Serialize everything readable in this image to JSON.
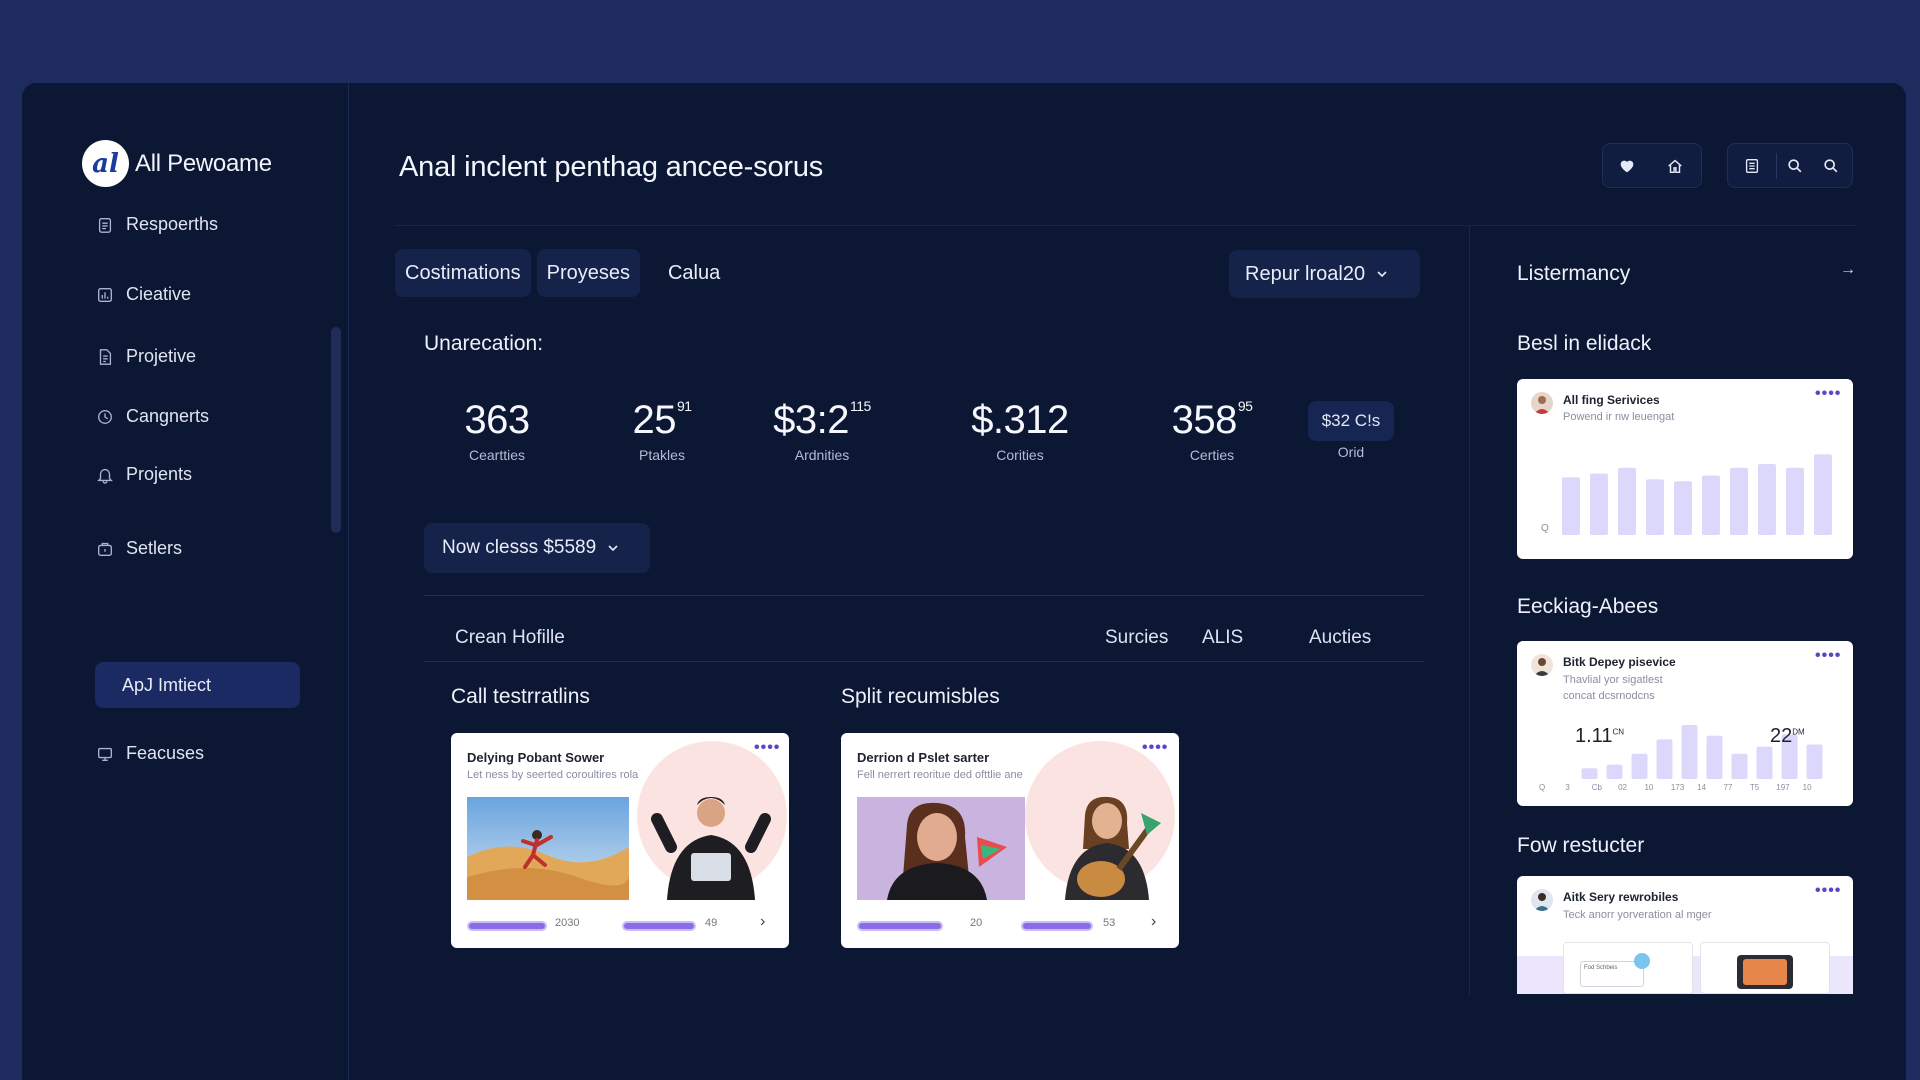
{
  "app": {
    "name": "All Pewoame",
    "logo_glyph": "al"
  },
  "sidebar": {
    "items": [
      {
        "label": "Respoerths",
        "icon": "clipboard-icon"
      },
      {
        "label": "Cieative",
        "icon": "chart-icon"
      },
      {
        "label": "Projetive",
        "icon": "document-icon"
      },
      {
        "label": "Cangnerts",
        "icon": "clock-icon"
      },
      {
        "label": "Projents",
        "icon": "bell-icon"
      },
      {
        "label": "Setlers",
        "icon": "briefcase-icon"
      }
    ],
    "active_item": {
      "label": "ApJ Imtiect"
    },
    "footer_item": {
      "label": "Feacuses",
      "icon": "monitor-icon"
    }
  },
  "header": {
    "title": "Anal inclent penthag ancee-sorus",
    "actions": [
      "heart-icon",
      "home-icon",
      "calendar-icon",
      "search-icon",
      "search-icon"
    ]
  },
  "tabs": [
    {
      "label": "Costimations",
      "active": false
    },
    {
      "label": "Proyeses",
      "active": true
    },
    {
      "label": "Calua",
      "active": false
    }
  ],
  "period_dropdown": {
    "value": "Repur lroal20"
  },
  "summary": {
    "label": "Unarecation:",
    "stats": [
      {
        "value": "363",
        "sup": "",
        "label": "Ceartties"
      },
      {
        "value": "25",
        "sup": "91",
        "label": "Ptakles"
      },
      {
        "value": "$3:2",
        "sup": "115",
        "label": "Ardnities"
      },
      {
        "value": "$.312",
        "sup": "",
        "label": "Corities"
      },
      {
        "value": "358",
        "sup": "95",
        "label": "Certies"
      }
    ],
    "badge": {
      "value": "$32 C!s",
      "label": "Orid"
    }
  },
  "filter": {
    "label": "Now clesss $5589"
  },
  "table": {
    "columns": [
      "Crean Hofille",
      "Surcies",
      "ALIS",
      "Aucties"
    ]
  },
  "sections": [
    {
      "title": "Call testrratlins",
      "card": {
        "title": "Delying Pobant Sower",
        "subtitle": "Let ness by seerted coroultires rola",
        "progress": [
          {
            "value": "2030"
          },
          {
            "value": "49"
          }
        ],
        "accent": "#8b6be8"
      }
    },
    {
      "title": "Split recumisbles",
      "card": {
        "title": "Derrion d Pslet sarter",
        "subtitle": "Fell nerrert reoritue ded ofttlie ane",
        "progress": [
          {
            "value": "20"
          },
          {
            "value": "53"
          }
        ],
        "accent": "#8b6be8"
      }
    }
  ],
  "right_panel": {
    "title": "Listermancy",
    "widgets": [
      {
        "heading": "Besl in elidack",
        "card_title": "All fing Serivices",
        "card_sub": "Powend ir nw leuengat",
        "axis_label": "Q",
        "bars": [
          0.6,
          0.64,
          0.7,
          0.58,
          0.56,
          0.62,
          0.7,
          0.74,
          0.7,
          0.84
        ]
      },
      {
        "heading": "Eeckiag-Abees",
        "card_title": "Bitk Depey pisevice",
        "card_sub1": "Thavlial yor sigatlest",
        "card_sub2": "concat dcsrnodcns",
        "metric1": "1.11",
        "metric1_sup": "CN",
        "metric2": "22",
        "metric2_sup": "DM",
        "ticks": [
          "Q",
          "3",
          "Cb",
          "02",
          "10",
          "173",
          "14",
          "77",
          "T5",
          "197",
          "10"
        ],
        "bars": [
          0.15,
          0.2,
          0.35,
          0.55,
          0.75,
          0.6,
          0.35,
          0.45,
          0.62,
          0.48
        ]
      },
      {
        "heading": "Fow restucter",
        "card_title": "Aitk Sery rewrobiles",
        "card_sub": "Teck anorr yorveration al mger",
        "mini_label": "Fod Schbeis"
      }
    ]
  },
  "colors": {
    "background": "#1e2b5e",
    "panel": "#0c1733",
    "accent": "#8b6be8",
    "bar_light": "#dcd8fb"
  }
}
